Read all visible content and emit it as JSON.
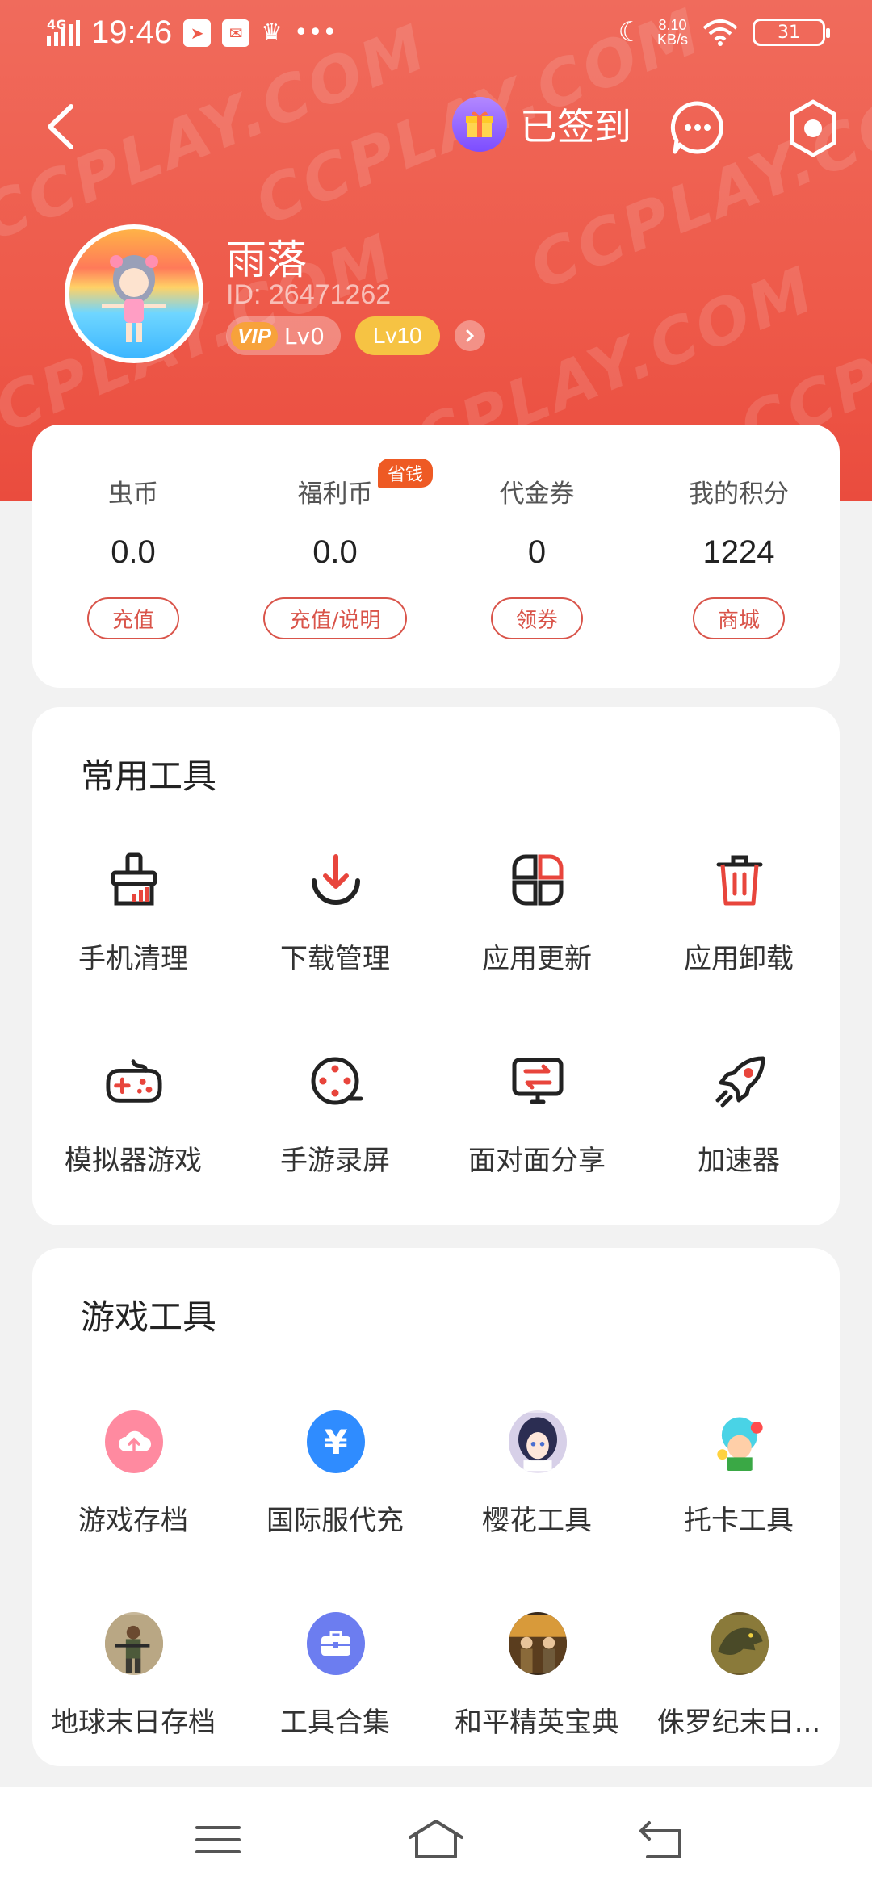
{
  "status_bar": {
    "network": "4G",
    "time": "19:46",
    "speed_value": "8.10",
    "speed_unit": "KB/s",
    "battery": "31"
  },
  "header": {
    "checkin_label": "已签到"
  },
  "watermark": "CCPLAY.COM",
  "profile": {
    "nickname": "雨落",
    "id_text": "ID: 26471262",
    "vip_label": "VIP",
    "vip_level": "Lv0",
    "level": "Lv10"
  },
  "wallet": {
    "items": [
      {
        "label": "虫币",
        "value": "0.0",
        "button": "充值"
      },
      {
        "label": "福利币",
        "value": "0.0",
        "button": "充值/说明",
        "tag": "省钱"
      },
      {
        "label": "代金券",
        "value": "0",
        "button": "领券"
      },
      {
        "label": "我的积分",
        "value": "1224",
        "button": "商城"
      }
    ]
  },
  "common_tools": {
    "title": "常用工具",
    "items": [
      {
        "label": "手机清理",
        "icon": "broom-icon"
      },
      {
        "label": "下载管理",
        "icon": "download-icon"
      },
      {
        "label": "应用更新",
        "icon": "apps-update-icon"
      },
      {
        "label": "应用卸载",
        "icon": "trash-icon"
      },
      {
        "label": "模拟器游戏",
        "icon": "gamepad-icon"
      },
      {
        "label": "手游录屏",
        "icon": "film-reel-icon"
      },
      {
        "label": "面对面分享",
        "icon": "transfer-screen-icon"
      },
      {
        "label": "加速器",
        "icon": "rocket-icon"
      }
    ]
  },
  "game_tools": {
    "title": "游戏工具",
    "items": [
      {
        "label": "游戏存档",
        "icon": "cloud-upload-icon"
      },
      {
        "label": "国际服代充",
        "icon": "yen-icon"
      },
      {
        "label": "樱花工具",
        "icon": "anime-girl-icon"
      },
      {
        "label": "托卡工具",
        "icon": "toca-kid-icon"
      },
      {
        "label": "地球末日存档",
        "icon": "soldier-icon"
      },
      {
        "label": "工具合集",
        "icon": "toolbox-icon"
      },
      {
        "label": "和平精英宝典",
        "icon": "squad-icon"
      },
      {
        "label": "侏罗纪末日...",
        "icon": "dinosaur-icon"
      }
    ]
  },
  "colors": {
    "brand": "#ee5a4a",
    "accent_red": "#e8453c",
    "level_badge": "#f6c343"
  }
}
